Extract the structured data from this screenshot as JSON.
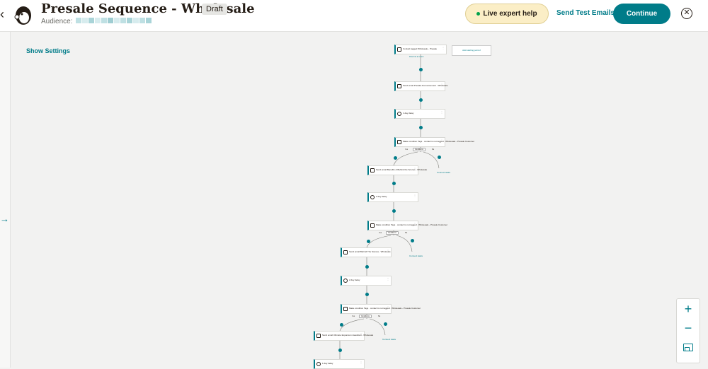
{
  "header": {
    "title": "Presale Sequence - Wholesale",
    "status": "Draft",
    "audience_label": "Audience:",
    "live_help": "Live expert help",
    "send_test": "Send Test Emails",
    "continue": "Continue"
  },
  "sidebar": {
    "show_settings": "Show Settings"
  },
  "flow": {
    "start_trigger": "Contact tagged Wholesale - Presale",
    "add_start": "Add starting point 2",
    "flow_into": "Flow into an event",
    "steps": [
      {
        "type": "email",
        "text": "Send email Presale Announcement - Wholesale"
      },
      {
        "type": "delay",
        "text": "1 day delay"
      },
      {
        "type": "condition",
        "text": "Make condition Tags · contact is not tagged · Wholesale - Presale Customer"
      },
      {
        "type": "email",
        "text": "Send email Benefits & Behind the Scenes - Wholesale"
      },
      {
        "type": "delay",
        "text": "2 day delay"
      },
      {
        "type": "condition",
        "text": "Make condition Tags · contact is not tagged · Wholesale - Presale Customer"
      },
      {
        "type": "email",
        "text": "Send email Behind The Scenes - Wholesale"
      },
      {
        "type": "delay",
        "text": "2 day delay"
      },
      {
        "type": "condition",
        "text": "Make condition Tags · contact is not tagged · Wholesale - Presale Customer"
      },
      {
        "type": "email",
        "text": "Send email Ultimate Expansion Headstart - Wholesale"
      },
      {
        "type": "delay",
        "text": "1 day delay"
      }
    ],
    "yes_label": "Yes",
    "no_label": "No",
    "conditions_label": "Conditions",
    "connect_label": "Connect tasks"
  },
  "zoom": {
    "plus": "+",
    "minus": "−"
  },
  "colors": {
    "accent": "#007c89",
    "help_bg": "#fbeec6"
  }
}
